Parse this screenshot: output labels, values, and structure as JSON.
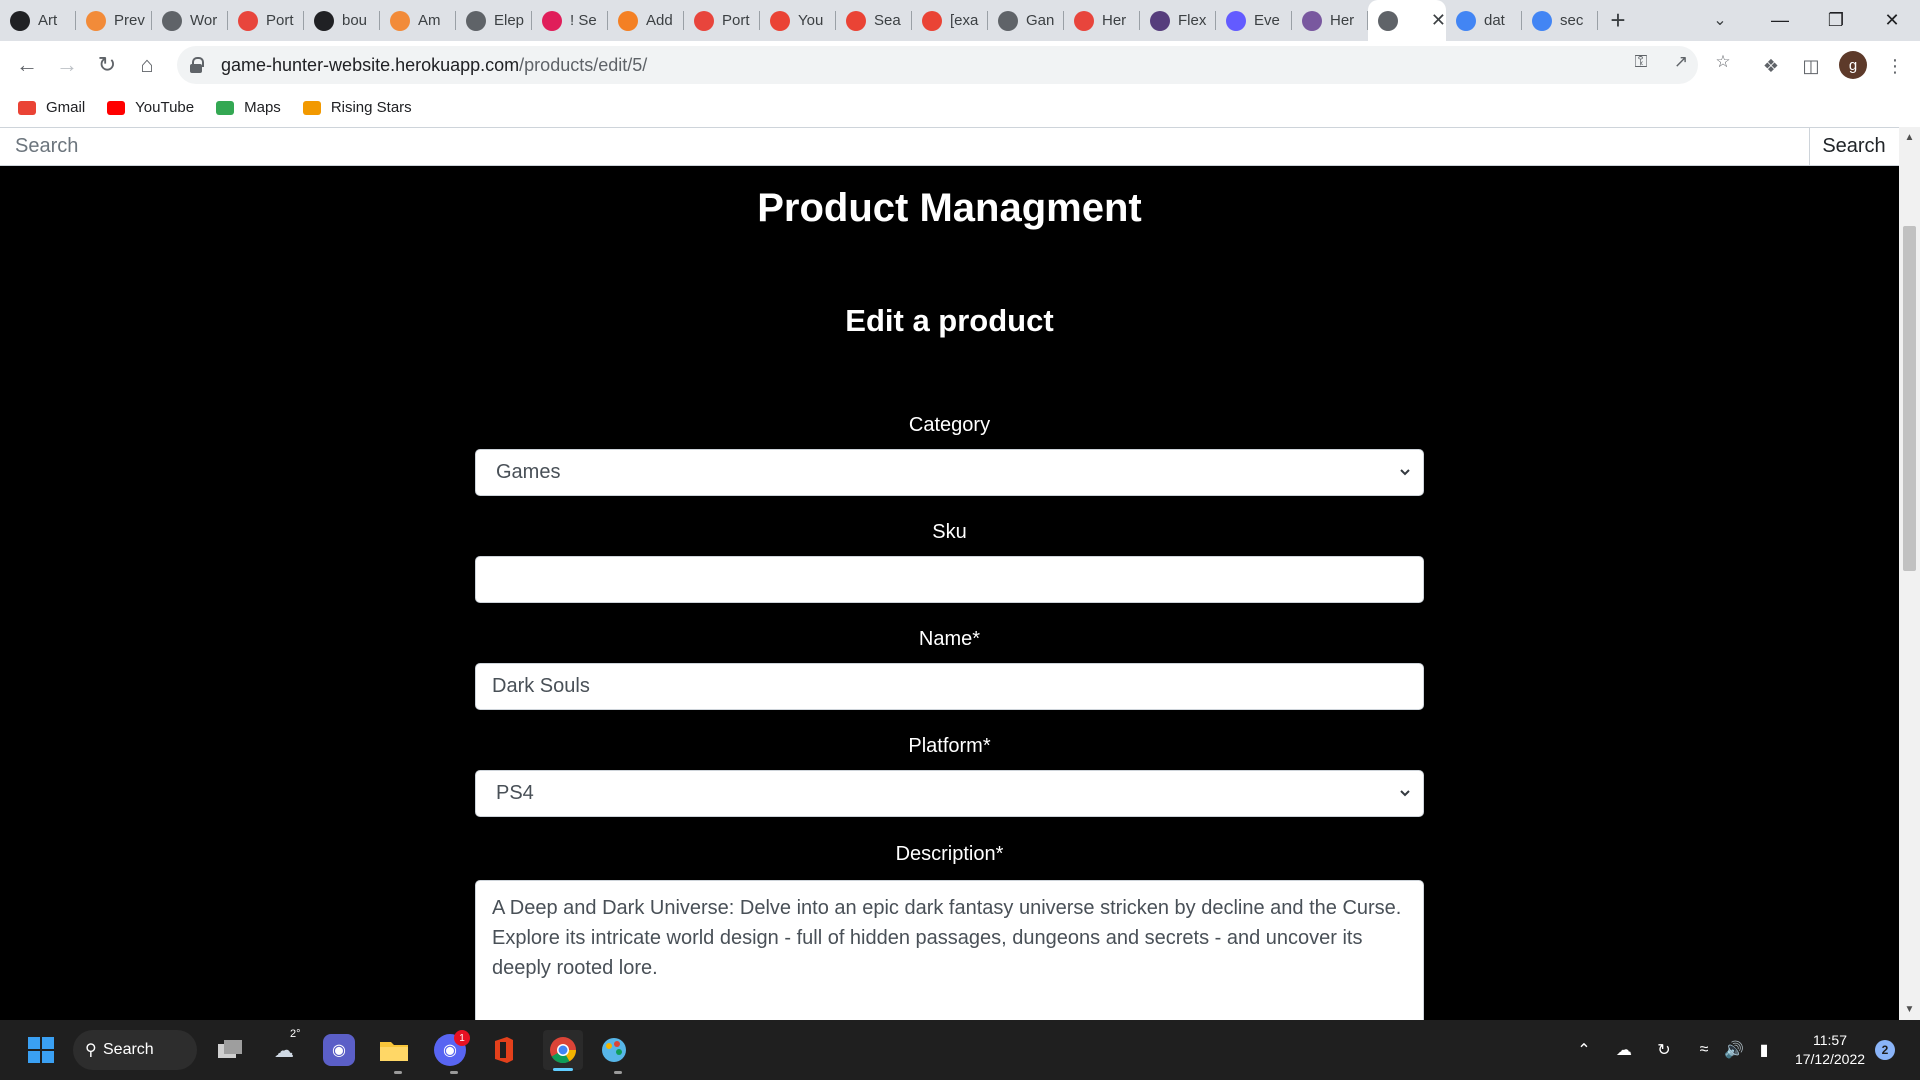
{
  "browser": {
    "tabs": [
      {
        "title": "Art",
        "icon": "github-icon",
        "color": "#202124"
      },
      {
        "title": "Prev",
        "icon": "preview-icon",
        "color": "#f28b39"
      },
      {
        "title": "Wor",
        "icon": "globe-icon",
        "color": "#5f6368"
      },
      {
        "title": "Port",
        "icon": "opera-icon",
        "color": "#e8453c"
      },
      {
        "title": "bou",
        "icon": "github-icon",
        "color": "#202124"
      },
      {
        "title": "Am",
        "icon": "cube-icon",
        "color": "#f28b39"
      },
      {
        "title": "Elep",
        "icon": "elephant-icon",
        "color": "#5f6368"
      },
      {
        "title": "! Se",
        "icon": "slack-icon",
        "color": "#e01e5a"
      },
      {
        "title": "Add",
        "icon": "stack-icon",
        "color": "#f48024"
      },
      {
        "title": "Port",
        "icon": "opera-icon",
        "color": "#e8453c"
      },
      {
        "title": "You",
        "icon": "gmail-icon",
        "color": "#ea4335"
      },
      {
        "title": "Sea",
        "icon": "gmail-icon",
        "color": "#ea4335"
      },
      {
        "title": "[exa",
        "icon": "gmail-icon",
        "color": "#ea4335"
      },
      {
        "title": "Gan",
        "icon": "globe-icon",
        "color": "#5f6368"
      },
      {
        "title": "Her",
        "icon": "opera-icon",
        "color": "#e8453c"
      },
      {
        "title": "Flex",
        "icon": "bootstrap-icon",
        "color": "#563d7c"
      },
      {
        "title": "Eve",
        "icon": "stripe-icon",
        "color": "#635bff"
      },
      {
        "title": "Her",
        "icon": "heroku-icon",
        "color": "#79589f"
      },
      {
        "title": "",
        "icon": "globe-icon",
        "color": "#5f6368",
        "active": true
      },
      {
        "title": "dat",
        "icon": "google-icon",
        "color": "#4285f4"
      },
      {
        "title": "sec",
        "icon": "google-icon",
        "color": "#4285f4"
      }
    ],
    "url_host": "game-hunter-website.herokuapp.com",
    "url_path": "/products/edit/5/",
    "profile_initial": "g",
    "bookmarks": [
      {
        "label": "Gmail",
        "icon": "gmail-icon",
        "color": "#ea4335"
      },
      {
        "label": "YouTube",
        "icon": "youtube-icon",
        "color": "#ff0000"
      },
      {
        "label": "Maps",
        "icon": "maps-icon",
        "color": "#34a853"
      },
      {
        "label": "Rising Stars",
        "icon": "star-icon",
        "color": "#f29900"
      }
    ]
  },
  "site": {
    "search_placeholder": "Search",
    "search_button": "Search",
    "title": "Product Managment",
    "subtitle": "Edit a product",
    "form": {
      "category_label": "Category",
      "category_value": "Games",
      "sku_label": "Sku",
      "sku_value": "",
      "name_label": "Name*",
      "name_value": "Dark Souls",
      "platform_label": "Platform*",
      "platform_value": "PS4",
      "description_label": "Description*",
      "description_value": "A Deep and Dark Universe: Delve into an epic dark fantasy universe stricken by decline and the Curse. Explore its intricate world design - full of hidden passages, dungeons and secrets - and uncover its deeply rooted lore."
    }
  },
  "taskbar": {
    "search_label": "Search",
    "weather_temp": "2°",
    "discord_badge": "1",
    "time": "11:57",
    "date": "17/12/2022",
    "notification_count": "2"
  }
}
